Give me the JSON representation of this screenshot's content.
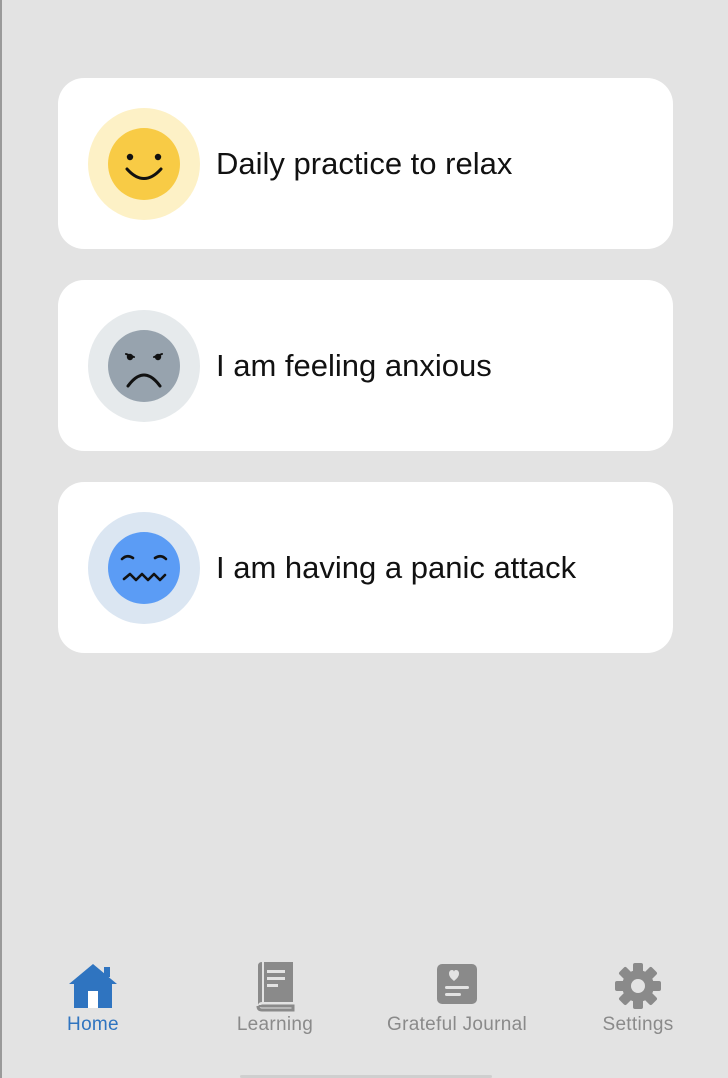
{
  "cards": [
    {
      "label": "Daily practice to relax",
      "icon": "smile-face-icon",
      "ring_color": "#fdf1c6",
      "face_color": "#f8cb45"
    },
    {
      "label": "I am feeling anxious",
      "icon": "frown-face-icon",
      "ring_color": "#e6eaec",
      "face_color": "#97a3ae"
    },
    {
      "label": "I am having a panic attack",
      "icon": "panic-face-icon",
      "ring_color": "#dbe6f2",
      "face_color": "#5b9cf5"
    }
  ],
  "tabs": [
    {
      "label": "Home",
      "icon": "home-icon",
      "active": true
    },
    {
      "label": "Learning",
      "icon": "book-icon",
      "active": false
    },
    {
      "label": "Grateful Journal",
      "icon": "journal-icon",
      "active": false
    },
    {
      "label": "Settings",
      "icon": "gear-icon",
      "active": false
    }
  ],
  "colors": {
    "background": "#e3e3e3",
    "card": "#ffffff",
    "tab_active": "#2f74c0",
    "tab_inactive": "#8a8a8a"
  }
}
